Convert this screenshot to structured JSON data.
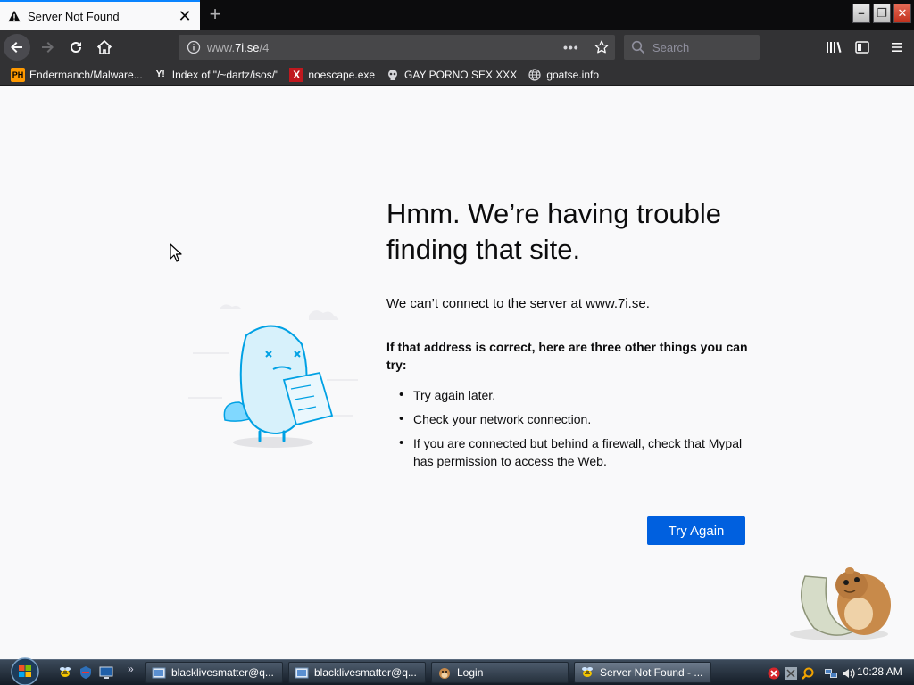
{
  "browser": {
    "tab": {
      "title": "Server Not Found",
      "close": "✕"
    },
    "new_tab": "+",
    "address": {
      "host": "www.",
      "domain": "7i.se",
      "path": "/4",
      "page_actions": "•••"
    },
    "search": {
      "placeholder": "Search"
    },
    "bookmarks": [
      {
        "label": "Endermanch/Malware...",
        "icon": "PH"
      },
      {
        "label": "Index of \"/~dartz/isos/\"",
        "icon": "Y!"
      },
      {
        "label": "noescape.exe",
        "icon": "X"
      },
      {
        "label": "GAY PORNO SEX XXX",
        "icon": "skull-icon"
      },
      {
        "label": "goatse.info",
        "icon": "globe-icon"
      }
    ]
  },
  "error": {
    "title": "Hmm. We’re having trouble finding that site.",
    "description": "We can’t connect to the server at www.7i.se.",
    "lead": "If that address is correct, here are three other things you can try:",
    "tips": [
      "Try again later.",
      "Check your network connection.",
      "If you are connected but behind a firewall, check that Mypal has permission to access the Web."
    ],
    "button": "Try Again"
  },
  "taskbar": {
    "overflow": "»",
    "tasks": [
      {
        "label": "blacklivesmatter@q..."
      },
      {
        "label": "blacklivesmatter@q..."
      },
      {
        "label": "Login"
      },
      {
        "label": "Server Not Found - ..."
      }
    ],
    "clock": "10:28 AM"
  },
  "colors": {
    "accent": "#0060df",
    "tab_highlight": "#0a84ff",
    "chrome": "#323234"
  }
}
